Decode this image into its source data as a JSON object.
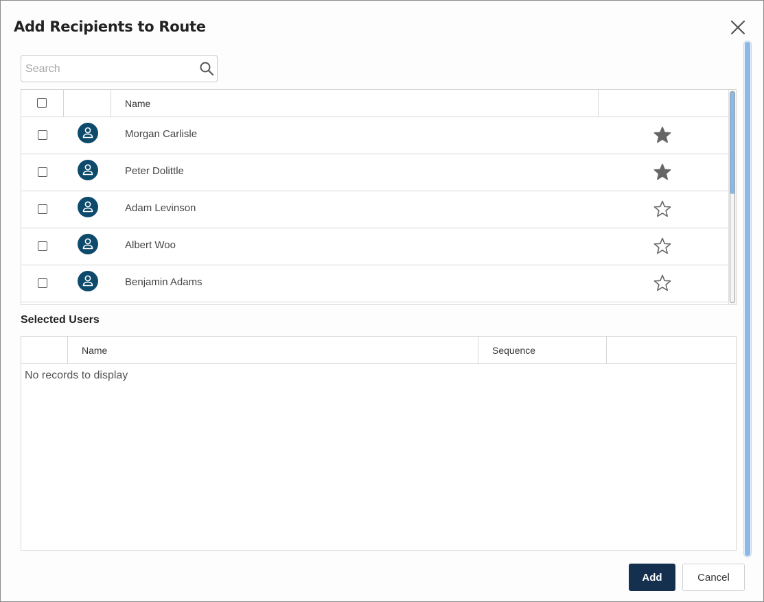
{
  "dialog": {
    "title": "Add Recipients to Route",
    "close_icon": "close-icon"
  },
  "search": {
    "placeholder": "Search",
    "value": "",
    "icon": "search-icon"
  },
  "recipients_grid": {
    "columns": [
      "",
      "",
      "Name",
      ""
    ],
    "rows": [
      {
        "name": "Morgan Carlisle",
        "checked": false,
        "favorite": true
      },
      {
        "name": "Peter Dolittle",
        "checked": false,
        "favorite": true
      },
      {
        "name": "Adam Levinson",
        "checked": false,
        "favorite": false
      },
      {
        "name": "Albert Woo",
        "checked": false,
        "favorite": false
      },
      {
        "name": "Benjamin Adams",
        "checked": false,
        "favorite": false
      }
    ]
  },
  "selected_users": {
    "title": "Selected Users",
    "columns": [
      "",
      "Name",
      "Sequence",
      ""
    ],
    "empty_text": "No records to display"
  },
  "footer": {
    "add_label": "Add",
    "cancel_label": "Cancel"
  },
  "colors": {
    "avatar": "#0d4a6b",
    "primary_button": "#15304f",
    "star": "#666666",
    "scroll_thumb": "#8ab8e8"
  }
}
